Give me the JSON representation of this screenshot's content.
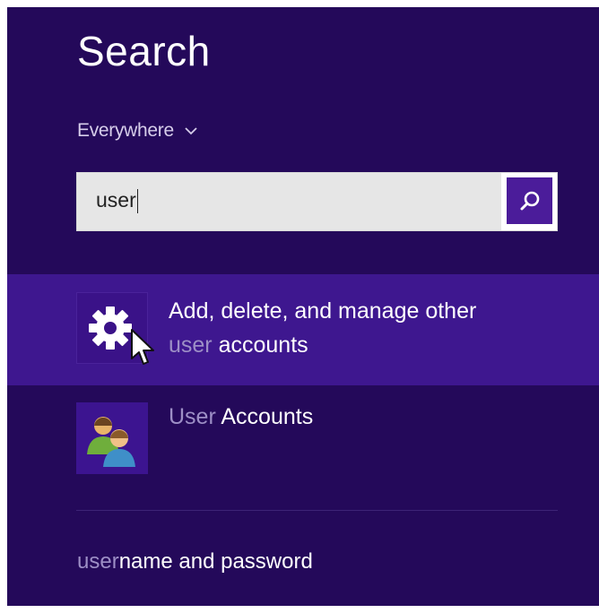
{
  "search_pane": {
    "title": "Search",
    "scope_label": "Everywhere",
    "query": "user"
  },
  "results": [
    {
      "match": "",
      "line1": "Add, delete, and manage other",
      "line2_match": "user",
      "line2_rest": " accounts",
      "icon": "gear-icon",
      "selected": true
    },
    {
      "match": "User",
      "rest": " Accounts",
      "icon": "user-accounts-icon",
      "selected": false
    }
  ],
  "suggestion": {
    "match": "user",
    "rest": "name and password"
  },
  "colors": {
    "pane_bg": "#24095a",
    "selected_bg": "#3e178f",
    "accent_button": "#4b1c9a",
    "match_text": "#9d8fc6"
  }
}
